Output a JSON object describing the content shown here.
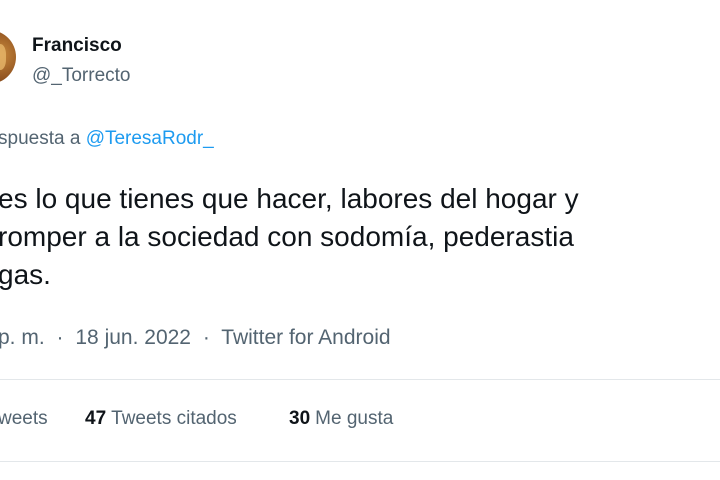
{
  "author": {
    "display_name": "Francisco",
    "handle": "@_Torrecto"
  },
  "reply": {
    "prefix": "spuesta a",
    "mention": "@TeresaRodr_"
  },
  "tweet": {
    "lines": [
      "es lo que tienes que hacer, labores del hogar y",
      "romper a la sociedad con sodomía, pederastia",
      "gas."
    ]
  },
  "meta": {
    "time": "p. m.",
    "separator": "·",
    "date": "18 jun. 2022",
    "source": "Twitter for Android"
  },
  "stats": {
    "retweets_label": "weets",
    "quote_count": "47",
    "quote_label": "Tweets citados",
    "like_count": "30",
    "like_label": "Me gusta"
  },
  "colors": {
    "text": "#0f1419",
    "secondary": "#536471",
    "link": "#1d9bf0",
    "divider": "#e3e7ea"
  }
}
